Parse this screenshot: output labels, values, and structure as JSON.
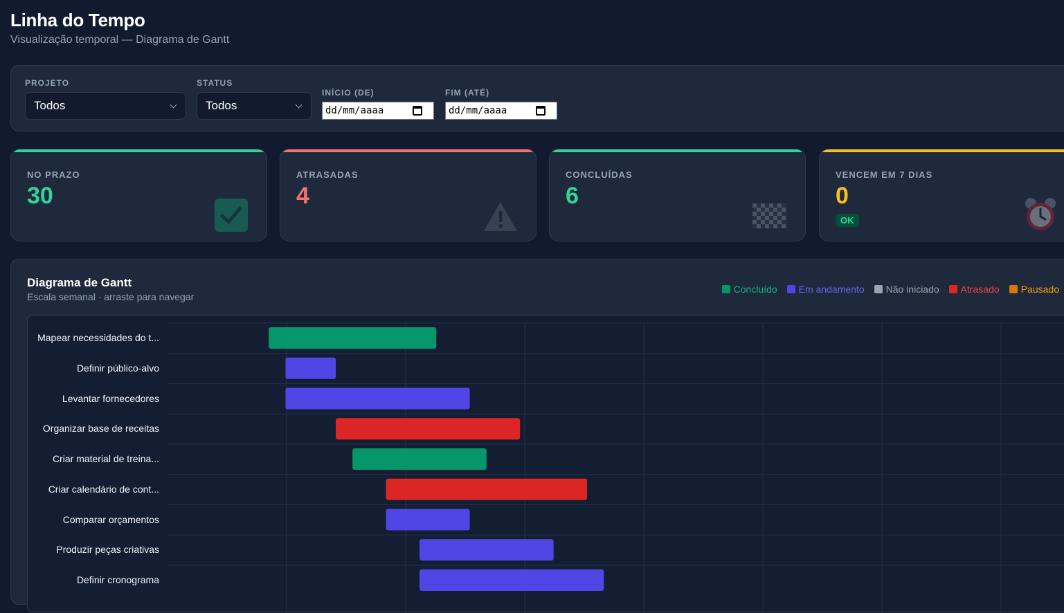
{
  "header": {
    "title": "Linha do Tempo",
    "subtitle": "Visualização temporal — Diagrama de Gantt"
  },
  "filters": {
    "project": {
      "label": "PROJETO",
      "value": "Todos"
    },
    "status": {
      "label": "STATUS",
      "value": "Todos"
    },
    "start": {
      "label": "INÍCIO (DE)",
      "value": "dd/mm/aaaa"
    },
    "end": {
      "label": "FIM (ATÉ)",
      "value": "dd/mm/aaaa"
    }
  },
  "kpis": [
    {
      "label": "NO PRAZO",
      "value": "30",
      "color": "#34d399",
      "icon": "check-icon"
    },
    {
      "label": "ATRASADAS",
      "value": "4",
      "color": "#f87171",
      "icon": "warning-icon"
    },
    {
      "label": "CONCLUÍDAS",
      "value": "6",
      "color": "#34d399",
      "icon": "checkered-flag-icon"
    },
    {
      "label": "VENCEM EM 7 DIAS",
      "value": "0",
      "color": "#fbbf24",
      "icon": "alarm-clock-icon",
      "badge": "OK"
    }
  ],
  "gantt": {
    "title": "Diagrama de Gantt",
    "subtitle": "Escala semanal · arraste para navegar",
    "legend": [
      {
        "label": "Concluído",
        "color": "#059669",
        "text_color": "#10b981"
      },
      {
        "label": "Em andamento",
        "color": "#4f46e5",
        "text_color": "#6366f1"
      },
      {
        "label": "Não iniciado",
        "color": "#9ca3af",
        "text_color": "#9ca3af"
      },
      {
        "label": "Atrasado",
        "color": "#dc2626",
        "text_color": "#ef4444"
      },
      {
        "label": "Pausado",
        "color": "#d97706",
        "text_color": "#f59e0b"
      }
    ],
    "tasks": [
      {
        "name": "Mapear necessidades do t...",
        "status": "Concluído",
        "start": 6.0,
        "end": 16.0
      },
      {
        "name": "Definir público-alvo",
        "status": "Em andamento",
        "start": 7.0,
        "end": 10.0
      },
      {
        "name": "Levantar fornecedores",
        "status": "Em andamento",
        "start": 7.0,
        "end": 18.0
      },
      {
        "name": "Organizar base de receitas",
        "status": "Atrasado",
        "start": 10.0,
        "end": 21.0
      },
      {
        "name": "Criar material de treina...",
        "status": "Concluído",
        "start": 11.0,
        "end": 19.0
      },
      {
        "name": "Criar calendário de cont...",
        "status": "Atrasado",
        "start": 13.0,
        "end": 25.0
      },
      {
        "name": "Comparar orçamentos",
        "status": "Em andamento",
        "start": 13.0,
        "end": 18.0
      },
      {
        "name": "Produzir peças criativas",
        "status": "Em andamento",
        "start": 15.0,
        "end": 23.0
      },
      {
        "name": "Definir cronograma",
        "status": "Em andamento",
        "start": 15.0,
        "end": 26.0
      }
    ]
  }
}
